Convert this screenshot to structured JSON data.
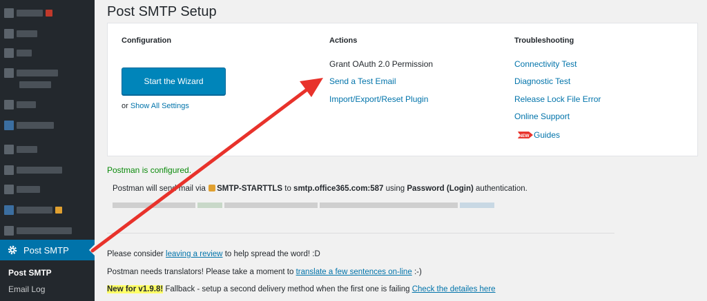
{
  "sidebar": {
    "active_item": "Post SMTP",
    "submenu": {
      "current": "Post SMTP",
      "email_log": "Email Log"
    }
  },
  "page": {
    "title": "Post SMTP Setup"
  },
  "configuration": {
    "heading": "Configuration",
    "wizard_button": "Start the Wizard",
    "or_text": "or",
    "show_all_settings": "Show All Settings"
  },
  "actions": {
    "heading": "Actions",
    "grant_oauth": "Grant OAuth 2.0 Permission",
    "send_test_email": "Send a Test Email",
    "import_export_reset": "Import/Export/Reset Plugin"
  },
  "troubleshooting": {
    "heading": "Troubleshooting",
    "connectivity_test": "Connectivity Test",
    "diagnostic_test": "Diagnostic Test",
    "release_lock": "Release Lock File Error",
    "online_support": "Online Support",
    "guides": "Guides",
    "new_badge": "NEW"
  },
  "status": {
    "configured": "Postman is configured.",
    "send_prefix": "Postman will send mail via",
    "transport": "SMTP-STARTTLS",
    "to_word": "to",
    "host": "smtp.office365.com:587",
    "using_word": "using",
    "auth": "Password (Login)",
    "suffix": "authentication."
  },
  "footer": {
    "review_prefix": "Please consider",
    "review_link": "leaving a review",
    "review_suffix": "to help spread the word! :D",
    "translate_prefix": "Postman needs translators! Please take a moment to",
    "translate_link": "translate a few sentences on-line",
    "translate_suffix": ":-)",
    "new_version": "New for v1.9.8!",
    "fallback_text": "Fallback - setup a second delivery method when the first one is failing",
    "details_link": "Check the detailes here"
  },
  "colors": {
    "admin_bar": "#23282d",
    "accent": "#0073aa",
    "button": "#0085ba",
    "success": "#0a8a0a",
    "annotation_arrow": "#e8322b",
    "highlight": "#ffff66"
  }
}
